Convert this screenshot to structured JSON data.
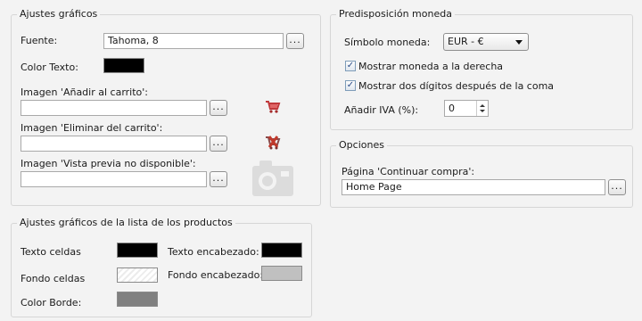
{
  "graphics": {
    "legend": "Ajustes gráficos",
    "font_label": "Fuente:",
    "font_value": "Tahoma, 8",
    "text_color_label": "Color Texto:",
    "text_color": "#000000",
    "add_cart_label": "Imagen 'Añadir al carrito':",
    "add_cart_value": "",
    "remove_cart_label": "Imagen 'Eliminar del carrito':",
    "remove_cart_value": "",
    "preview_label": "Imagen 'Vista previa no disponible':",
    "preview_value": "",
    "browse_label": "..."
  },
  "product_list": {
    "legend": "Ajustes gráficos de la lista de los productos",
    "cell_text_label": "Texto celdas",
    "cell_text_color": "#000000",
    "header_text_label": "Texto encabezado:",
    "header_text_color": "#000000",
    "cell_bg_label": "Fondo celdas",
    "cell_bg_color": "#ffffff",
    "header_bg_label": "Fondo encabezado:",
    "header_bg_color": "#c0c0c0",
    "border_color_label": "Color Borde:",
    "border_color": "#808080"
  },
  "currency": {
    "legend": "Predisposición moneda",
    "symbol_label": "Símbolo moneda:",
    "symbol_value": "EUR - €",
    "right_label": "Mostrar moneda a la derecha",
    "right_checked": true,
    "decimals_label": "Mostrar dos dígitos después de la coma",
    "decimals_checked": true,
    "vat_label": "Añadir IVA (%):",
    "vat_value": "0"
  },
  "options": {
    "legend": "Opciones",
    "continue_label": "Página 'Continuar compra':",
    "continue_value": "Home Page",
    "browse_label": "..."
  },
  "icons": {
    "add_cart": "cart-add-icon",
    "remove_cart": "cart-remove-icon",
    "preview": "camera-icon"
  }
}
